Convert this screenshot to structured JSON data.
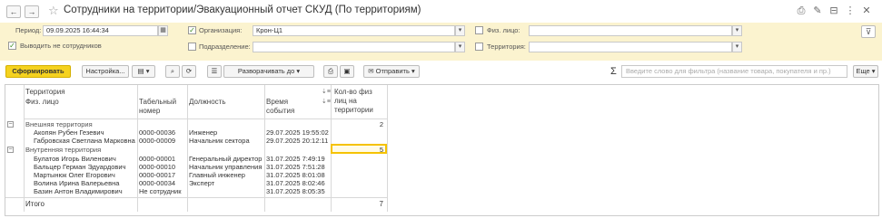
{
  "window": {
    "title": "Сотрудники на территории/Эвакуационный отчет СКУД (По территориям)",
    "back_icon": "arrow-left",
    "forward_icon": "arrow-right",
    "favorite_icon": "star"
  },
  "filters": {
    "period_label": "Период:",
    "period_value": "09.09.2025 16:44:34",
    "org_label": "Организация:",
    "org_value": "Крон-Ц1",
    "phys_label": "Физ. лицо:",
    "show_non_employees_label": "Выводить не сотрудников",
    "subdivision_label": "Подразделение:",
    "territory_label": "Территория:"
  },
  "toolbar": {
    "generate": "Сформировать",
    "settings": "Настройка...",
    "expand_to": "Разворачивать до",
    "send": "Отправить",
    "search_placeholder": "Введите слово для фильтра (название товара, покупателя и пр.)",
    "more": "Еще"
  },
  "table": {
    "headers": {
      "territory": "Территория",
      "person": "Физ. лицо",
      "tab_number": "Табельный\nномер",
      "position": "Должность",
      "event_time": "Время\nсобытия",
      "count": "Кол-во физ\nлиц на\nтерритории"
    },
    "groups": [
      {
        "name": "Внешняя территория",
        "count": "2",
        "rows": [
          {
            "person": "Акопян Рубен Гезевич",
            "tab": "0000-00036",
            "position": "Инженер",
            "time": "29.07.2025 19:55:02"
          },
          {
            "person": "Габровская Светлана Марковна",
            "tab": "0000-00009",
            "position": "Начальник сектора",
            "time": "29.07.2025 20:12:11"
          }
        ]
      },
      {
        "name": "Внутренняя территория",
        "count": "5",
        "rows": [
          {
            "person": "Булатов Игорь Виленович",
            "tab": "0000-00001",
            "position": "Генеральный директор",
            "time": "31.07.2025 7:49:19"
          },
          {
            "person": "Бальцер Герман Эдуардович",
            "tab": "0000-00010",
            "position": "Начальник управления",
            "time": "31.07.2025 7:51:28"
          },
          {
            "person": "Мартынюк Олег Егорович",
            "tab": "0000-00017",
            "position": "Главный инженер",
            "time": "31.07.2025 8:01:08"
          },
          {
            "person": "Волина Ирина Валерьевна",
            "tab": "0000-00034",
            "position": "Эксперт",
            "time": "31.07.2025 8:02:46"
          },
          {
            "person": "Базин Антон Владимирович",
            "tab": "Не сотрудник",
            "position": "",
            "time": "31.07.2025 8:05:35"
          }
        ]
      }
    ],
    "total_label": "Итого",
    "total_count": "7"
  },
  "colors": {
    "filter_bg": "#fbf3cf",
    "primary_button": "#f5d21f",
    "selection_border": "#f5c200"
  }
}
